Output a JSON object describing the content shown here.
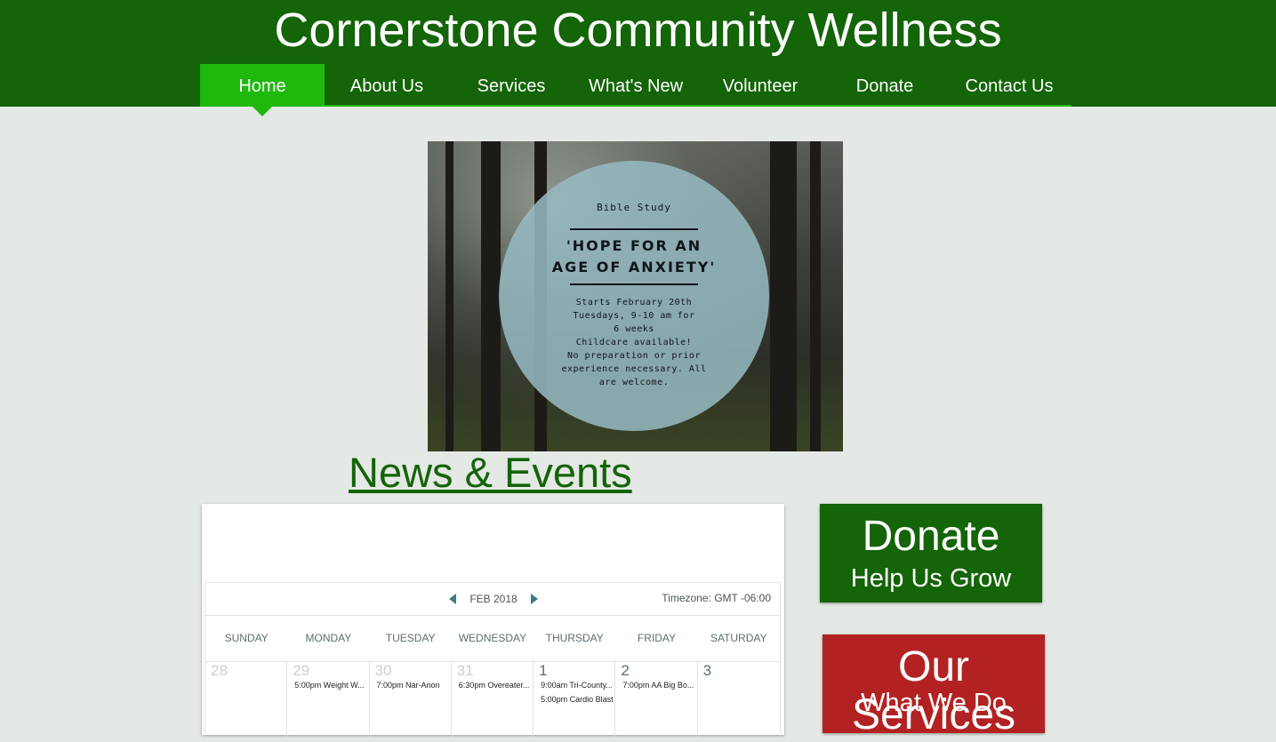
{
  "header": {
    "site_title": "Cornerstone Community Wellness",
    "background_color": "#146408",
    "active_color": "#1fb80d"
  },
  "nav": {
    "items": [
      {
        "label": "Home",
        "active": true
      },
      {
        "label": "About Us"
      },
      {
        "label": "Services"
      },
      {
        "label": "What's New"
      },
      {
        "label": "Volunteer"
      },
      {
        "label": "Donate"
      },
      {
        "label": "Contact Us"
      }
    ]
  },
  "banner": {
    "label": "Bible Study",
    "headline_line1": "'HOPE FOR AN",
    "headline_line2": "AGE OF ANXIETY'",
    "details": [
      "Starts February 20th",
      "Tuesdays, 9-10 am for",
      "6 weeks",
      "Childcare available!",
      "No preparation or prior",
      "experience necessary.  All",
      "are welcome."
    ]
  },
  "news": {
    "heading": "News & Events"
  },
  "calendar": {
    "month_label": "FEB 2018",
    "timezone": "Timezone: GMT -06:00",
    "day_names": [
      "SUNDAY",
      "MONDAY",
      "TUESDAY",
      "WEDNESDAY",
      "THURSDAY",
      "FRIDAY",
      "SATURDAY"
    ],
    "cells": [
      {
        "num": "28",
        "muted": true,
        "events": []
      },
      {
        "num": "29",
        "muted": true,
        "events": [
          "5:00pm Weight W..."
        ]
      },
      {
        "num": "30",
        "muted": true,
        "events": [
          "7:00pm Nar-Anon"
        ]
      },
      {
        "num": "31",
        "muted": true,
        "events": [
          "6:30pm Overeater..."
        ]
      },
      {
        "num": "1",
        "muted": false,
        "events": [
          "9:00am Tri-County...",
          "5:00pm Cardio Blast"
        ]
      },
      {
        "num": "2",
        "muted": false,
        "events": [
          "7:00pm AA Big Bo..."
        ]
      },
      {
        "num": "3",
        "muted": false,
        "events": []
      }
    ]
  },
  "sidebar": {
    "donate": {
      "title": "Donate",
      "subtitle": "Help Us Grow",
      "color": "#146408"
    },
    "services": {
      "title": "Our Services",
      "subtitle": "What We Do",
      "color": "#b22222"
    }
  }
}
